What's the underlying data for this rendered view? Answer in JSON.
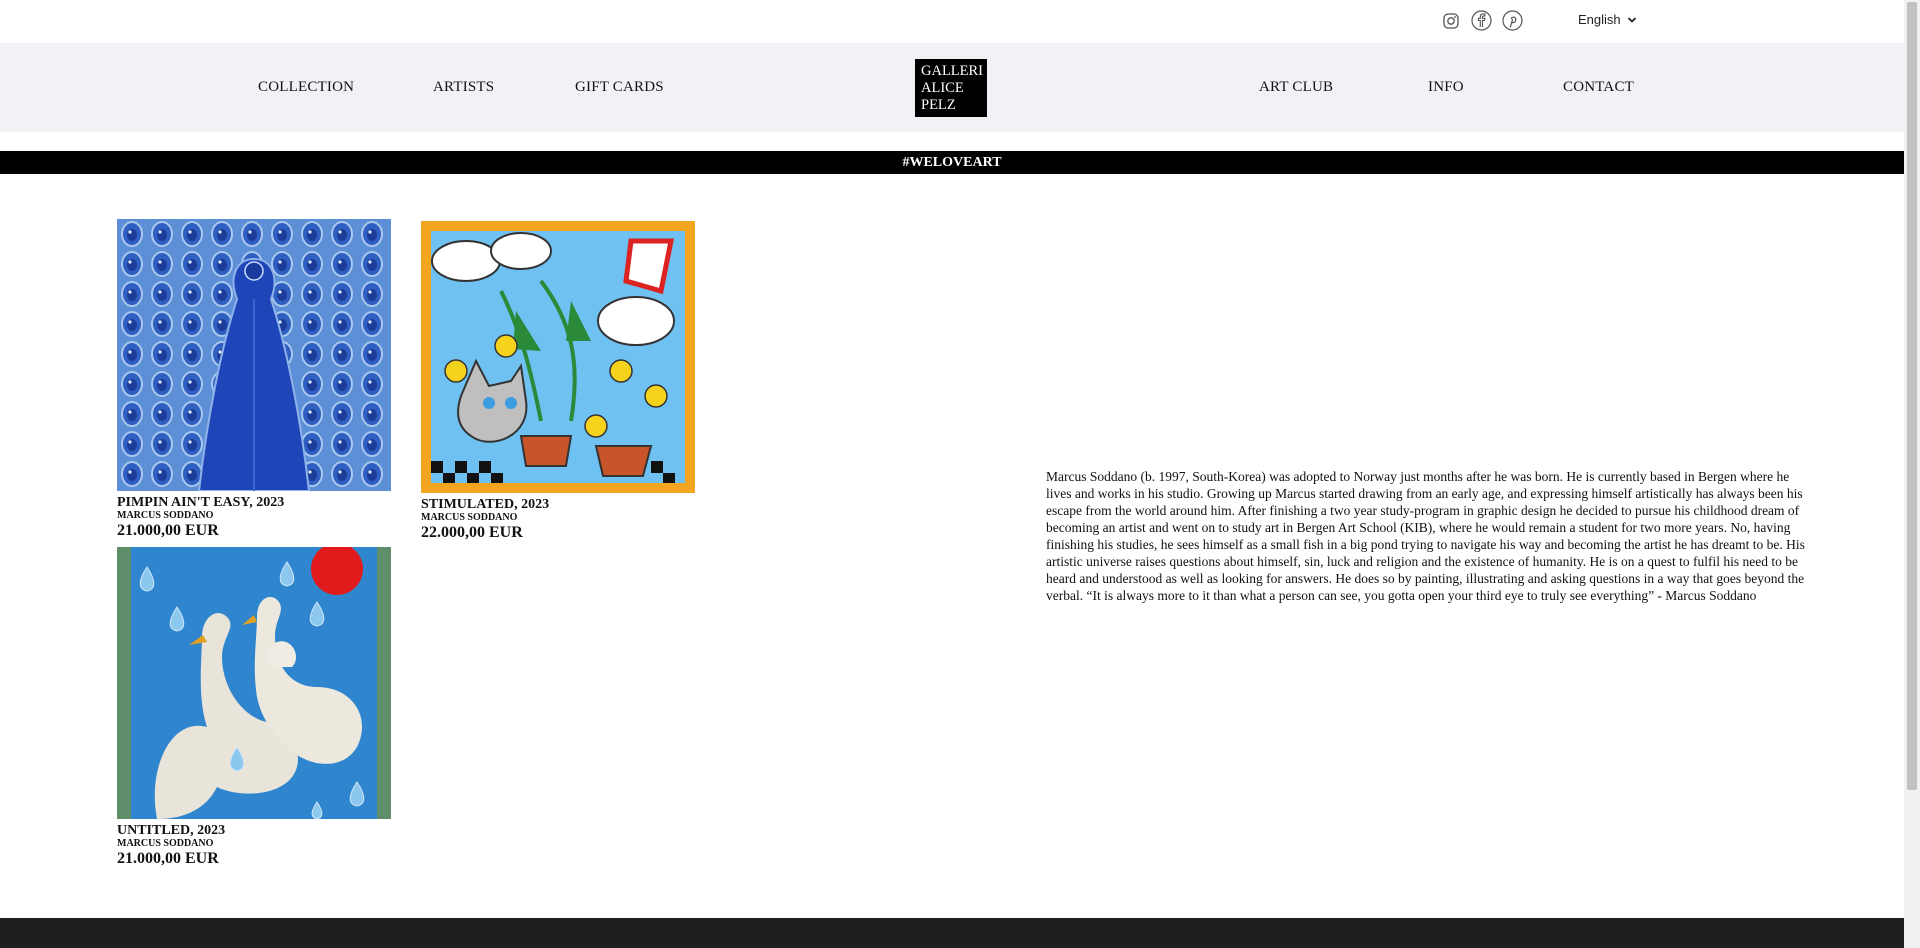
{
  "social": {
    "icons": [
      "instagram-icon",
      "facebook-icon",
      "pinterest-icon"
    ]
  },
  "language": {
    "selected": "English"
  },
  "nav": {
    "left": [
      "COLLECTION",
      "ARTISTS",
      "GIFT CARDS"
    ],
    "logo": [
      "GALLERI",
      "ALICE",
      "PELZ"
    ],
    "right": [
      "ART CLUB",
      "INFO",
      "CONTACT"
    ]
  },
  "banner": "#WELOVEART",
  "artworks": [
    {
      "title": "PIMPIN AIN'T EASY, 2023",
      "artist": "MARCUS SODDANO",
      "price": "21.000,00 EUR"
    },
    {
      "title": "STIMULATED, 2023",
      "artist": "MARCUS SODDANO",
      "price": "22.000,00 EUR"
    },
    {
      "title": "UNTITLED, 2023",
      "artist": "MARCUS SODDANO",
      "price": "21.000,00 EUR"
    }
  ],
  "bio": "Marcus Soddano (b. 1997, South-Korea) was adopted to Norway just months after he was born. He is currently based in Bergen where he lives and works in his studio. Growing up Marcus started drawing from an early age, and expressing himself artistically has always been his escape from the world around him. After finishing a two year study-program in graphic design he decided to pursue his childhood dream of becoming an artist and went on to study art in Bergen Art School (KIB), where he would remain a student for two more years. No, having finishing his studies, he sees himself as a small fish in a big pond trying to navigate his way and becoming the artist he has dreamt to be. His artistic universe raises questions about himself, sin, luck and religion and the existence of humanity. He is on a quest to fulfil his need to be heard and understood as well as looking for answers. He does so by painting, illustrating and asking questions in a way that goes beyond the verbal. “It is always more to it than what a person can see, you gotta open your third eye to truly see everything” - Marcus Soddano"
}
